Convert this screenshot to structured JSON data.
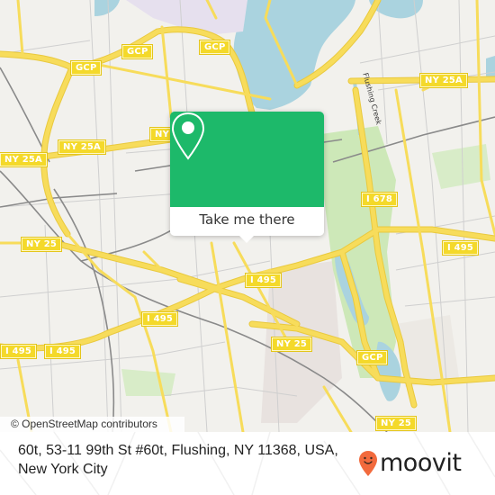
{
  "map": {
    "attribution": "© OpenStreetMap contributors",
    "colors": {
      "background": "#f2f1ed",
      "water": "#aad3df",
      "park": "#cde8b8",
      "highway": "#f7dc5b",
      "road": "#bdbdbd",
      "rail": "#8a8a8a",
      "urban": "#e8e2df"
    },
    "shields": [
      {
        "label": "GCP"
      },
      {
        "label": "GCP"
      },
      {
        "label": "GCP"
      },
      {
        "label": "NY 25A"
      },
      {
        "label": "NY 25A"
      },
      {
        "label": "NY 25A"
      },
      {
        "label": "NY 25A"
      },
      {
        "label": "NY 25"
      },
      {
        "label": "I 495"
      },
      {
        "label": "I 495"
      },
      {
        "label": "I 495"
      },
      {
        "label": "I 495"
      },
      {
        "label": "I 495"
      },
      {
        "label": "I 678"
      },
      {
        "label": "NY 25"
      },
      {
        "label": "GCP"
      },
      {
        "label": "NY 25"
      }
    ],
    "street_labels": [
      {
        "label": "Flushing Creek"
      }
    ]
  },
  "popup": {
    "icon": "location-pin-icon",
    "cta_label": "Take me there",
    "color": "#1db96a"
  },
  "footer": {
    "address": "60t, 53-11 99th St #60t, Flushing, NY 11368, USA, New York City",
    "brand": {
      "name": "moovit",
      "icon": "moovit-pin-logo-icon",
      "color": "#f26a3d"
    }
  }
}
